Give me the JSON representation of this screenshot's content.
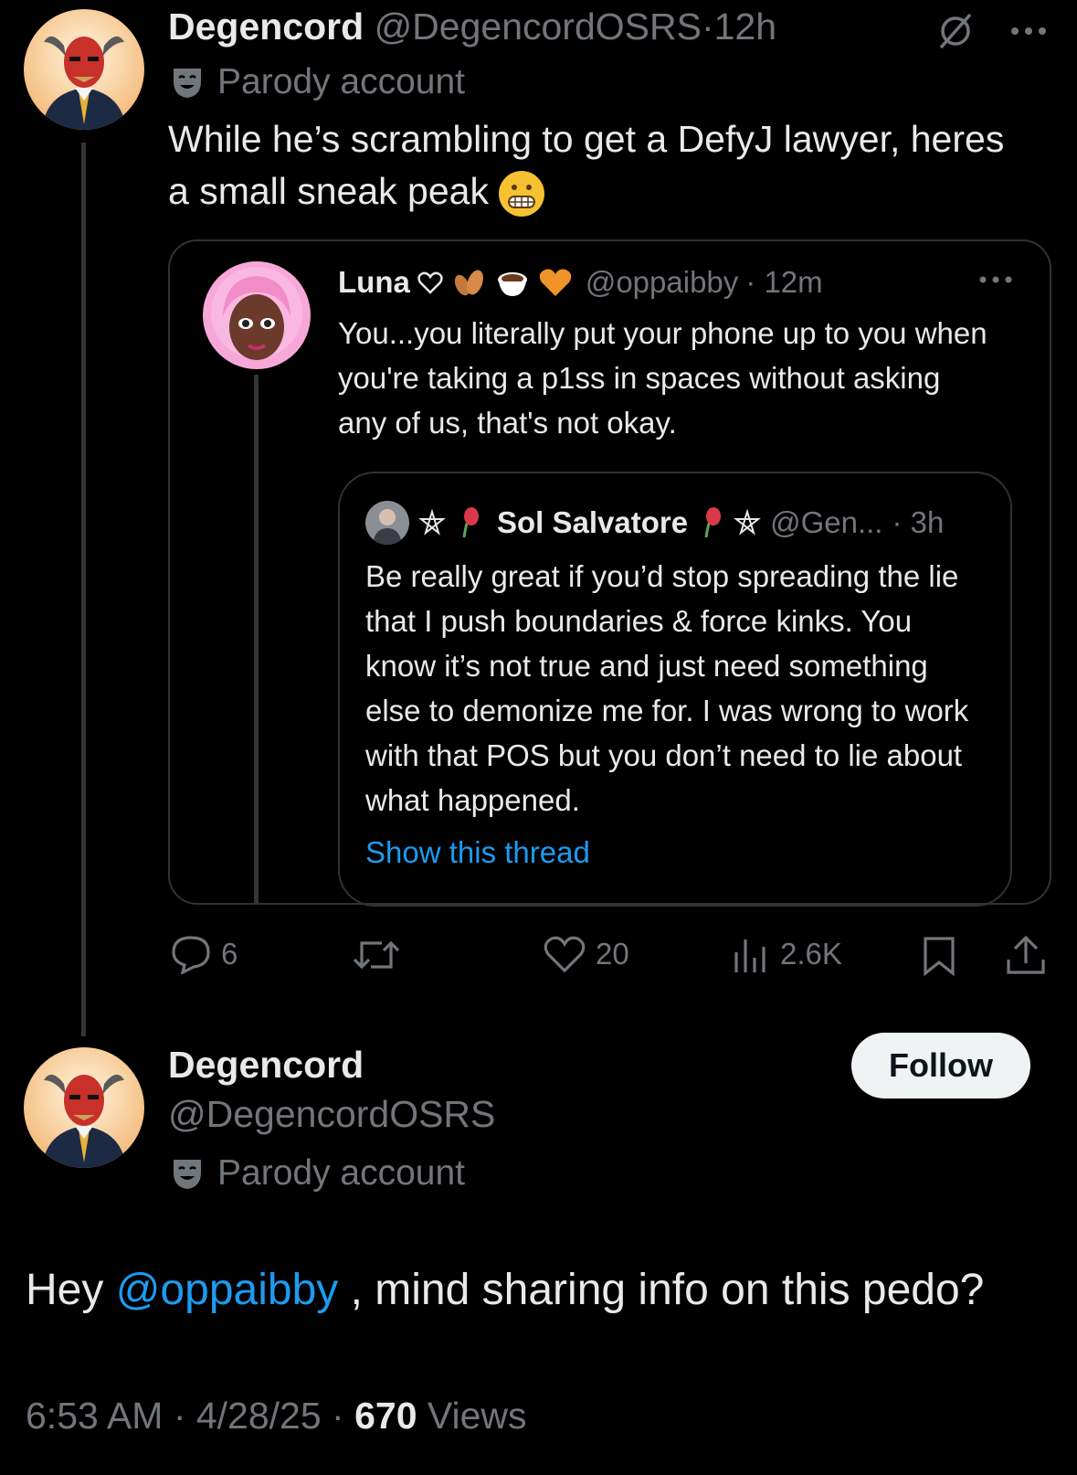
{
  "tweet1": {
    "display_name": "Degencord",
    "handle": "@DegencordOSRS",
    "separator": "·",
    "time": "12h",
    "badge_label": "Parody account",
    "text": "While he’s scrambling to get a DefyJ lawyer, heres a small sneak peak",
    "icons": [
      "grok-icon",
      "more-icon",
      "grimacing-face-emoji"
    ]
  },
  "quote": {
    "display_name": "Luna",
    "handle": "@oppaibby",
    "time": "· 12m",
    "text": "You...you literally put your phone up to you when you're taking a p1ss in spaces without asking any of us, that's not okay.",
    "inner": {
      "display_name": "Sol Salvatore",
      "handle": "@Gen...",
      "time": "· 3h",
      "text": "Be really great if you’d stop spreading the lie that I push boundaries & force kinks. You know it’s not true and just need something else to demonize me for. I was wrong to work with that POS but you don’t need to lie about what happened.",
      "show_thread": "Show this thread"
    }
  },
  "actions": {
    "replies": "6",
    "likes": "20",
    "views": "2.6K"
  },
  "tweet2": {
    "display_name": "Degencord",
    "handle": "@DegencordOSRS",
    "badge_label": "Parody account",
    "follow_label": "Follow",
    "text_prefix": "Hey ",
    "mention": "@oppaibby",
    "text_suffix": " , mind sharing info on this pedo?",
    "time": "6:53 AM · 4/28/25 · ",
    "views_count": "670",
    "views_label": " Views"
  },
  "colors": {
    "background": "#000000",
    "text": "#e7e9ea",
    "muted": "#71767b",
    "link": "#1d9bf0",
    "follow_bg": "#eff3f4"
  }
}
